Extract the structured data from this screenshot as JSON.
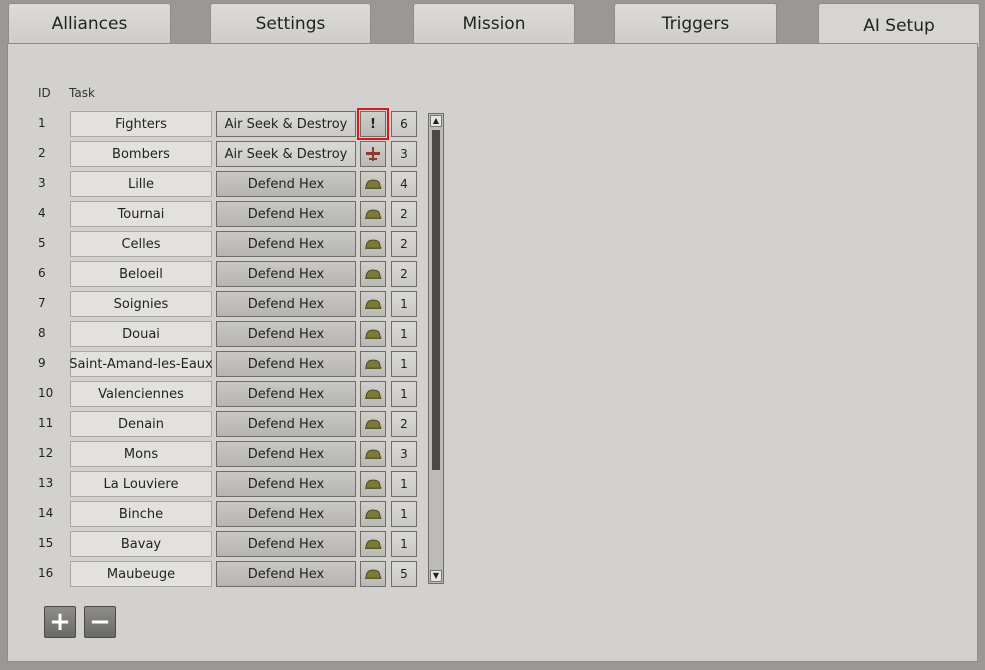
{
  "tabs": [
    {
      "label": "Alliances"
    },
    {
      "label": "Settings"
    },
    {
      "label": "Mission"
    },
    {
      "label": "Triggers"
    },
    {
      "label": "AI Setup"
    }
  ],
  "active_tab": "AI Setup",
  "table": {
    "headers": {
      "id": "ID",
      "task": "Task"
    },
    "rows": [
      {
        "id": "1",
        "name": "Fighters",
        "task": "Air Seek & Destroy",
        "icon": "exclamation-icon",
        "icon_text": "!",
        "count": "6"
      },
      {
        "id": "2",
        "name": "Bombers",
        "task": "Air Seek & Destroy",
        "icon": "bomber-plane-icon",
        "count": "3"
      },
      {
        "id": "3",
        "name": "Lille",
        "task": "Defend Hex",
        "icon": "helmet-icon",
        "count": "4"
      },
      {
        "id": "4",
        "name": "Tournai",
        "task": "Defend Hex",
        "icon": "helmet-icon",
        "count": "2"
      },
      {
        "id": "5",
        "name": "Celles",
        "task": "Defend Hex",
        "icon": "helmet-icon",
        "count": "2"
      },
      {
        "id": "6",
        "name": "Beloeil",
        "task": "Defend Hex",
        "icon": "helmet-icon",
        "count": "2"
      },
      {
        "id": "7",
        "name": "Soignies",
        "task": "Defend Hex",
        "icon": "helmet-icon",
        "count": "1"
      },
      {
        "id": "8",
        "name": "Douai",
        "task": "Defend Hex",
        "icon": "helmet-icon",
        "count": "1"
      },
      {
        "id": "9",
        "name": "Saint-Amand-les-Eaux",
        "task": "Defend Hex",
        "icon": "helmet-icon",
        "count": "1"
      },
      {
        "id": "10",
        "name": "Valenciennes",
        "task": "Defend Hex",
        "icon": "helmet-icon",
        "count": "1"
      },
      {
        "id": "11",
        "name": "Denain",
        "task": "Defend Hex",
        "icon": "helmet-icon",
        "count": "2"
      },
      {
        "id": "12",
        "name": "Mons",
        "task": "Defend Hex",
        "icon": "helmet-icon",
        "count": "3"
      },
      {
        "id": "13",
        "name": "La Louviere",
        "task": "Defend Hex",
        "icon": "helmet-icon",
        "count": "1"
      },
      {
        "id": "14",
        "name": "Binche",
        "task": "Defend Hex",
        "icon": "helmet-icon",
        "count": "1"
      },
      {
        "id": "15",
        "name": "Bavay",
        "task": "Defend Hex",
        "icon": "helmet-icon",
        "count": "1"
      },
      {
        "id": "16",
        "name": "Maubeuge",
        "task": "Defend Hex",
        "icon": "helmet-icon",
        "count": "5"
      }
    ]
  },
  "buttons": {
    "add": "+",
    "remove": "−"
  },
  "colors": {
    "selection": "#d8181c",
    "helmet": "#7b7a3a"
  }
}
